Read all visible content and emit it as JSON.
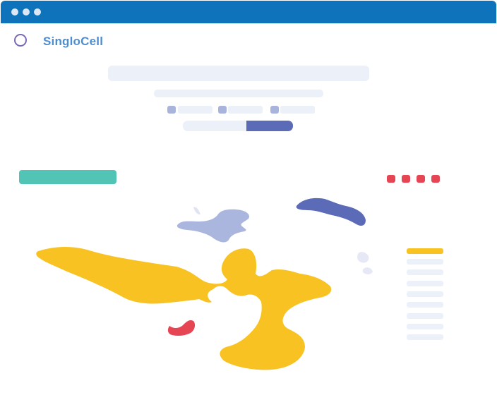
{
  "app": {
    "brand": "SingloCell"
  },
  "colors": {
    "titlebar": "#0e73bb",
    "brand_text": "#4f8dd1",
    "logo_ring": "#7a68b4",
    "placeholder": "#ecf0f9",
    "toggle_active": "#5b6bb7",
    "accent_green": "#52c4b5",
    "window_button_red": "#e64554",
    "cluster_yellow": "#f7c222",
    "cluster_blue": "#5b6bb7",
    "cluster_light_blue": "#aab6de",
    "cluster_red": "#e64554",
    "cluster_pale": "#e6e9f5"
  },
  "icons": {
    "window_dots": "window-control-dot-icon",
    "logo": "ring-logo-icon"
  },
  "toolbar": {
    "option_count": 3,
    "toggle_selected": "right"
  },
  "panel": {
    "buttons": [
      "red",
      "red",
      "red",
      "red"
    ],
    "legend_items": 9,
    "legend_active_index": 0
  },
  "clusters": [
    "yellow",
    "blue",
    "light-blue",
    "red",
    "pale"
  ]
}
